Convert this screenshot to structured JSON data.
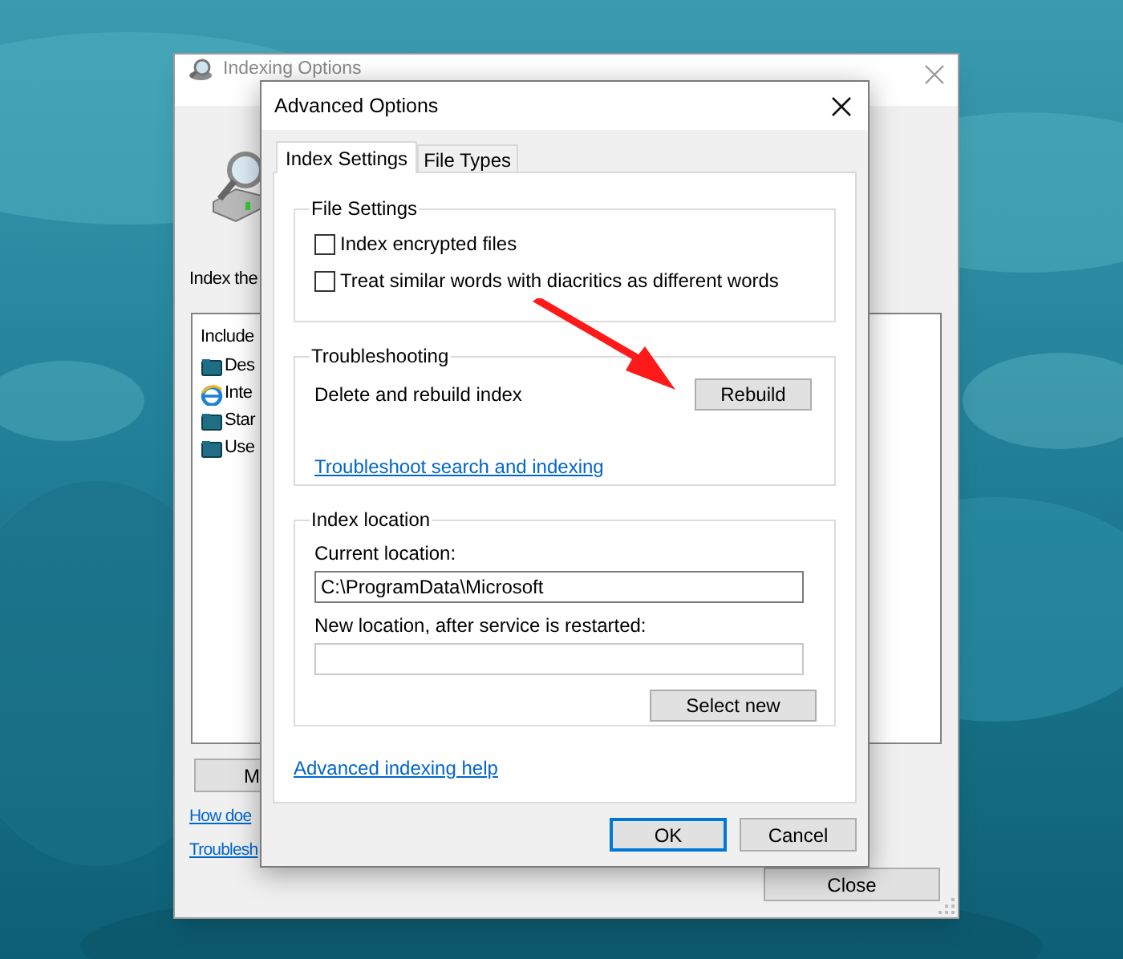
{
  "back_window": {
    "title": "Indexing Options",
    "intro": "Index the",
    "list_header": "Include",
    "locations": [
      {
        "name": "Des",
        "kind": "folder"
      },
      {
        "name": "Inte",
        "kind": "browser"
      },
      {
        "name": "Star",
        "kind": "folder"
      },
      {
        "name": "Use",
        "kind": "folder"
      }
    ],
    "modify_button": "M",
    "links": [
      "How doe",
      "Troublesh"
    ],
    "close_button": "Close"
  },
  "dialog": {
    "title": "Advanced Options",
    "tabs": [
      {
        "label": "Index Settings",
        "selected": true
      },
      {
        "label": "File Types",
        "selected": false
      }
    ],
    "file_settings": {
      "title": "File Settings",
      "options": [
        {
          "label": "Index encrypted files",
          "checked": false
        },
        {
          "label": "Treat similar words with diacritics as different words",
          "checked": false
        }
      ]
    },
    "troubleshooting": {
      "title": "Troubleshooting",
      "label": "Delete and rebuild index",
      "button": "Rebuild",
      "link": "Troubleshoot search and indexing"
    },
    "index_location": {
      "title": "Index location",
      "current_label": "Current location:",
      "current_value": "C:\\ProgramData\\Microsoft",
      "new_label": "New location, after service is restarted:",
      "button": "Select new"
    },
    "help_link": "Advanced indexing help",
    "buttons": [
      {
        "label": "OK",
        "default": true
      },
      {
        "label": "Cancel",
        "default": false
      }
    ]
  }
}
